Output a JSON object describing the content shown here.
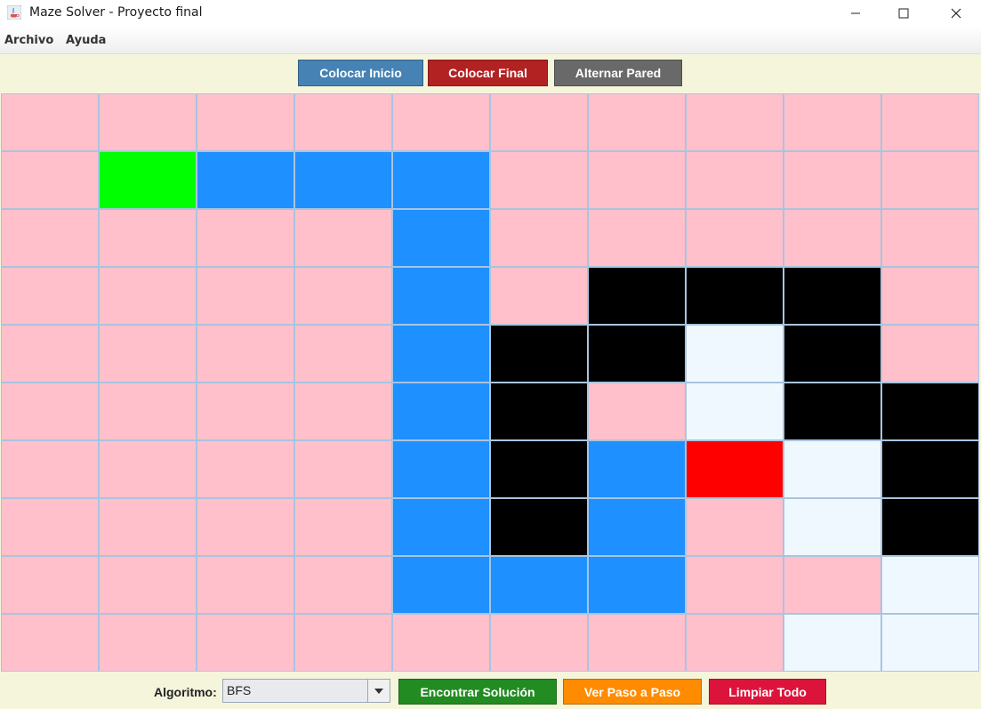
{
  "window": {
    "title": "Maze Solver - Proyecto final"
  },
  "menu": [
    {
      "label": "Archivo"
    },
    {
      "label": "Ayuda"
    }
  ],
  "toolbar": {
    "buttons": [
      {
        "label": "Colocar Inicio",
        "color": "#4682b4"
      },
      {
        "label": "Colocar Final",
        "color": "#b22222"
      },
      {
        "label": "Alternar Pared",
        "color": "#696969"
      }
    ]
  },
  "grid": {
    "rows": 10,
    "cols": 10,
    "legend": {
      "empty": "#ffc0cb",
      "start": "#00ff00",
      "end": "#ff0000",
      "wall": "#000000",
      "path": "#1e90ff",
      "visited": "#f0f8ff"
    },
    "cells": [
      [
        "empty",
        "empty",
        "empty",
        "empty",
        "empty",
        "empty",
        "empty",
        "empty",
        "empty",
        "empty"
      ],
      [
        "empty",
        "start",
        "path",
        "path",
        "path",
        "empty",
        "empty",
        "empty",
        "empty",
        "empty"
      ],
      [
        "empty",
        "empty",
        "empty",
        "empty",
        "path",
        "empty",
        "empty",
        "empty",
        "empty",
        "empty"
      ],
      [
        "empty",
        "empty",
        "empty",
        "empty",
        "path",
        "empty",
        "wall",
        "wall",
        "wall",
        "empty"
      ],
      [
        "empty",
        "empty",
        "empty",
        "empty",
        "path",
        "wall",
        "wall",
        "visited",
        "wall",
        "empty"
      ],
      [
        "empty",
        "empty",
        "empty",
        "empty",
        "path",
        "wall",
        "empty",
        "visited",
        "wall",
        "wall"
      ],
      [
        "empty",
        "empty",
        "empty",
        "empty",
        "path",
        "wall",
        "path",
        "end",
        "visited",
        "wall"
      ],
      [
        "empty",
        "empty",
        "empty",
        "empty",
        "path",
        "wall",
        "path",
        "empty",
        "visited",
        "wall"
      ],
      [
        "empty",
        "empty",
        "empty",
        "empty",
        "path",
        "path",
        "path",
        "empty",
        "empty",
        "visited"
      ],
      [
        "empty",
        "empty",
        "empty",
        "empty",
        "empty",
        "empty",
        "empty",
        "empty",
        "visited",
        "visited"
      ]
    ]
  },
  "bottom": {
    "algorithm_label": "Algoritmo:",
    "algorithm_value": "BFS",
    "buttons": [
      {
        "label": "Encontrar Solución",
        "color": "#228b22"
      },
      {
        "label": "Ver Paso a Paso",
        "color": "#ff8c00"
      },
      {
        "label": "Limpiar Todo",
        "color": "#dc143c"
      }
    ]
  }
}
